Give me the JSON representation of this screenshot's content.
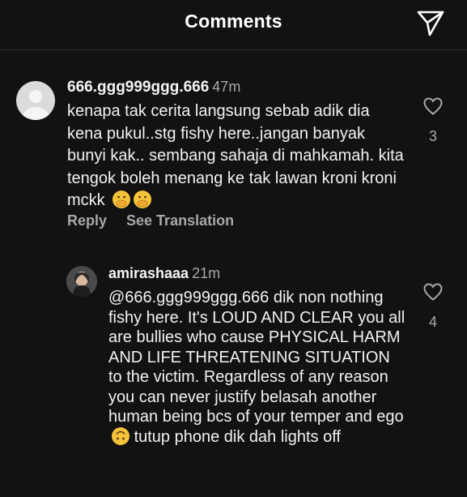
{
  "header": {
    "title": "Comments"
  },
  "comments": [
    {
      "username": "666.ggg999ggg.666",
      "time": "47m",
      "text": "kenapa tak cerita langsung sebab adik dia kena pukul..stg fishy here..jangan banyak bunyi kak.. sembang sahaja di mahkamah. kita tengok boleh menang ke tak lawan kroni kroni mckk",
      "emojis": [
        "hand-over-mouth-emoji",
        "hand-over-mouth-emoji"
      ],
      "likes": "3",
      "reply_label": "Reply",
      "translate_label": "See Translation"
    },
    {
      "username": "amirashaaa",
      "time": "21m",
      "text_part1": "@666.ggg999ggg.666 dik non nothing fishy here. It's LOUD AND CLEAR you all are bullies who cause PHYSICAL HARM AND LIFE THREATENING SITUATION to the victim. Regardless of any reason you can never justify belasah another human being bcs of your temper and ego",
      "emoji": "upside-down-face-emoji",
      "text_part2": "tutup phone dik dah lights off",
      "likes": "4"
    }
  ],
  "colors": {
    "background": "#121212",
    "text": "#f5f5f5",
    "muted": "#a8a8a8"
  },
  "icons": {
    "send": "send-icon",
    "like": "heart-outline-icon"
  }
}
